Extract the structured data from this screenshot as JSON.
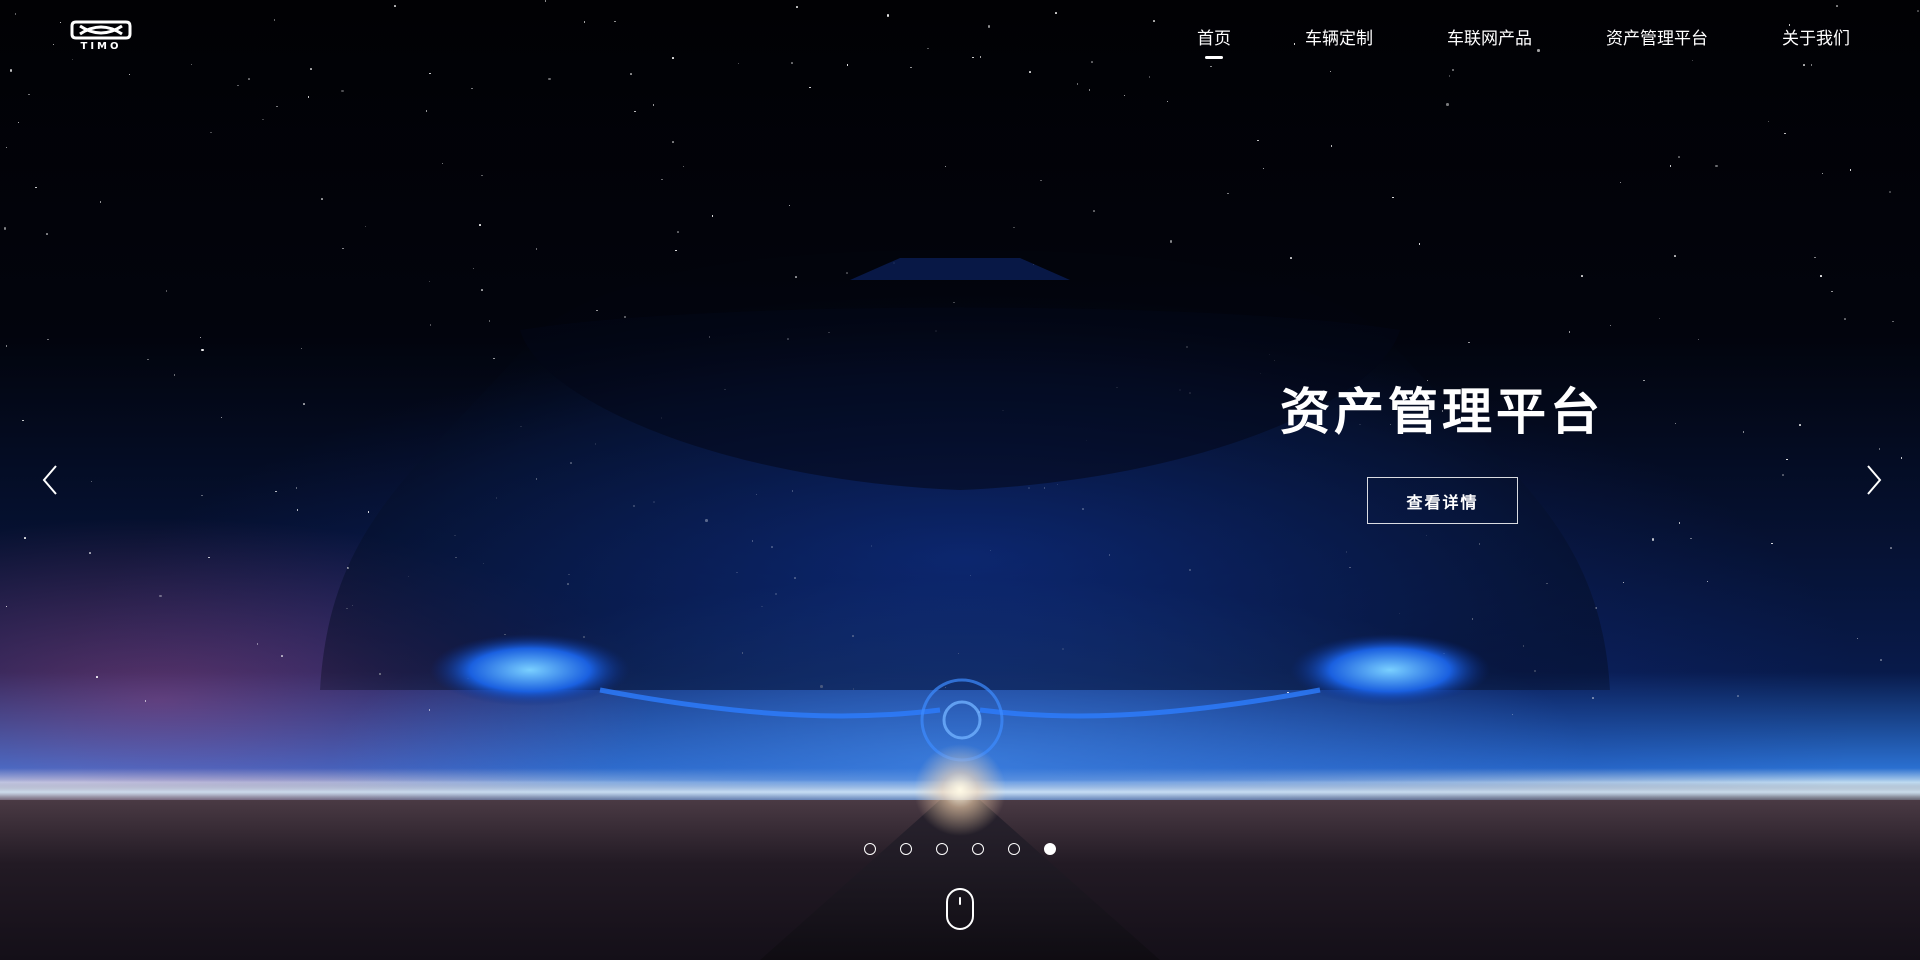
{
  "header": {
    "logo_text": "TIMO",
    "nav": [
      {
        "label": "首页",
        "active": true
      },
      {
        "label": "车辆定制",
        "active": false
      },
      {
        "label": "车联网产品",
        "active": false
      },
      {
        "label": "资产管理平台",
        "active": false
      },
      {
        "label": "关于我们",
        "active": false
      }
    ]
  },
  "slide": {
    "title": "资产管理平台",
    "button_label": "查看详情"
  },
  "carousel": {
    "dot_count": 6,
    "active_index": 5
  },
  "icons": {
    "logo": "infinity-logo-icon",
    "prev": "chevron-left-icon",
    "next": "chevron-right-icon",
    "scroll": "mouse-scroll-icon"
  },
  "colors": {
    "text": "#ffffff",
    "sky_top": "#010104",
    "horizon": "#2a6fd0"
  }
}
